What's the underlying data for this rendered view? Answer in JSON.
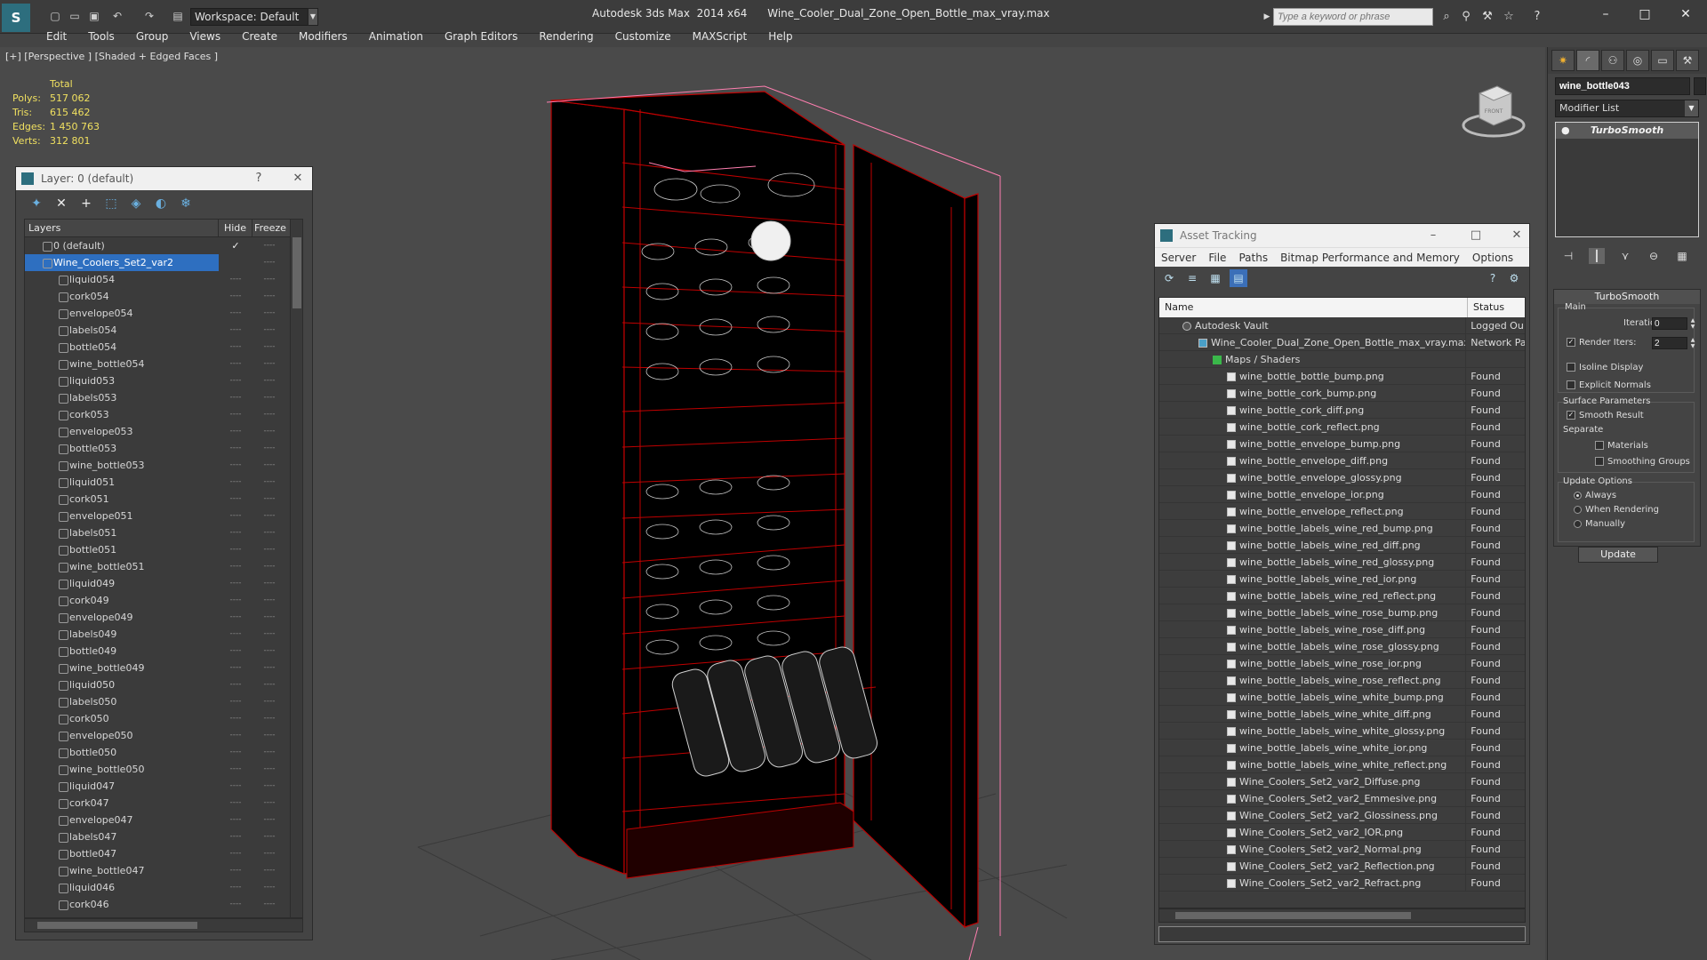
{
  "titlebar": {
    "app_name": "Autodesk 3ds Max  2014 x64",
    "file_name": "Wine_Cooler_Dual_Zone_Open_Bottle_max_vray.max",
    "workspace": "Workspace: Default",
    "search_placeholder": "Type a keyword or phrase"
  },
  "menubar": [
    "Edit",
    "Tools",
    "Group",
    "Views",
    "Create",
    "Modifiers",
    "Animation",
    "Graph Editors",
    "Rendering",
    "Customize",
    "MAXScript",
    "Help"
  ],
  "viewport": {
    "label": "[+] [Perspective ] [Shaded + Edged Faces ]",
    "stats": {
      "header": "Total",
      "polys_label": "Polys:",
      "polys": "517 062",
      "tris_label": "Tris:",
      "tris": "615 462",
      "edges_label": "Edges:",
      "edges": "1 450 763",
      "verts_label": "Verts:",
      "verts": "312 801"
    },
    "viewcube_label": "FRONT"
  },
  "layer_panel": {
    "title": "Layer: 0 (default)",
    "help": "?",
    "close": "✕",
    "col_layers": "Layers",
    "col_hide": "Hide",
    "col_freeze": "Freeze",
    "top_layers": [
      {
        "name": "0 (default)",
        "check": "✓"
      },
      {
        "name": "Wine_Coolers_Set2_var2",
        "check": ""
      }
    ],
    "objects": [
      "liquid054",
      "cork054",
      "envelope054",
      "labels054",
      "bottle054",
      "wine_bottle054",
      "liquid053",
      "labels053",
      "cork053",
      "envelope053",
      "bottle053",
      "wine_bottle053",
      "liquid051",
      "cork051",
      "envelope051",
      "labels051",
      "bottle051",
      "wine_bottle051",
      "liquid049",
      "cork049",
      "envelope049",
      "labels049",
      "bottle049",
      "wine_bottle049",
      "liquid050",
      "labels050",
      "cork050",
      "envelope050",
      "bottle050",
      "wine_bottle050",
      "liquid047",
      "cork047",
      "envelope047",
      "labels047",
      "bottle047",
      "wine_bottle047",
      "liquid046",
      "cork046"
    ],
    "dash": "----"
  },
  "asset_panel": {
    "title": "Asset Tracking",
    "menu": [
      "Server",
      "File",
      "Paths",
      "Bitmap Performance and Memory",
      "Options"
    ],
    "col_name": "Name",
    "col_status": "Status",
    "vault": {
      "name": "Autodesk Vault",
      "status": "Logged Ou"
    },
    "file": {
      "name": "Wine_Cooler_Dual_Zone_Open_Bottle_max_vray.max",
      "status": "Network Pa"
    },
    "maps_group": "Maps / Shaders",
    "found": "Found",
    "maps": [
      "wine_bottle_bottle_bump.png",
      "wine_bottle_cork_bump.png",
      "wine_bottle_cork_diff.png",
      "wine_bottle_cork_reflect.png",
      "wine_bottle_envelope_bump.png",
      "wine_bottle_envelope_diff.png",
      "wine_bottle_envelope_glossy.png",
      "wine_bottle_envelope_ior.png",
      "wine_bottle_envelope_reflect.png",
      "wine_bottle_labels_wine_red_bump.png",
      "wine_bottle_labels_wine_red_diff.png",
      "wine_bottle_labels_wine_red_glossy.png",
      "wine_bottle_labels_wine_red_ior.png",
      "wine_bottle_labels_wine_red_reflect.png",
      "wine_bottle_labels_wine_rose_bump.png",
      "wine_bottle_labels_wine_rose_diff.png",
      "wine_bottle_labels_wine_rose_glossy.png",
      "wine_bottle_labels_wine_rose_ior.png",
      "wine_bottle_labels_wine_rose_reflect.png",
      "wine_bottle_labels_wine_white_bump.png",
      "wine_bottle_labels_wine_white_diff.png",
      "wine_bottle_labels_wine_white_glossy.png",
      "wine_bottle_labels_wine_white_ior.png",
      "wine_bottle_labels_wine_white_reflect.png",
      "Wine_Coolers_Set2_var2_Diffuse.png",
      "Wine_Coolers_Set2_var2_Emmesive.png",
      "Wine_Coolers_Set2_var2_Glossiness.png",
      "Wine_Coolers_Set2_var2_IOR.png",
      "Wine_Coolers_Set2_var2_Normal.png",
      "Wine_Coolers_Set2_var2_Reflection.png",
      "Wine_Coolers_Set2_var2_Refract.png"
    ]
  },
  "command_panel": {
    "object_name": "wine_bottle043",
    "modifier_list": "Modifier List",
    "stack_item": "TurboSmooth",
    "rollout_title": "TurboSmooth",
    "main_label": "Main",
    "iterations_label": "Iterations:",
    "iterations": "0",
    "render_iters_label": "Render Iters:",
    "render_iters": "2",
    "isoline": "Isoline Display",
    "explicit_normals": "Explicit Normals",
    "surface_label": "Surface Parameters",
    "smooth_result": "Smooth Result",
    "separate_label": "Separate",
    "materials": "Materials",
    "smoothing_groups": "Smoothing Groups",
    "update_label": "Update Options",
    "always": "Always",
    "when_rendering": "When Rendering",
    "manually": "Manually",
    "update_button": "Update"
  },
  "colors": {
    "wire": "#c00000",
    "selection": "#2e6fc0",
    "stats": "#f0e060",
    "pink": "#ff7fb0"
  }
}
